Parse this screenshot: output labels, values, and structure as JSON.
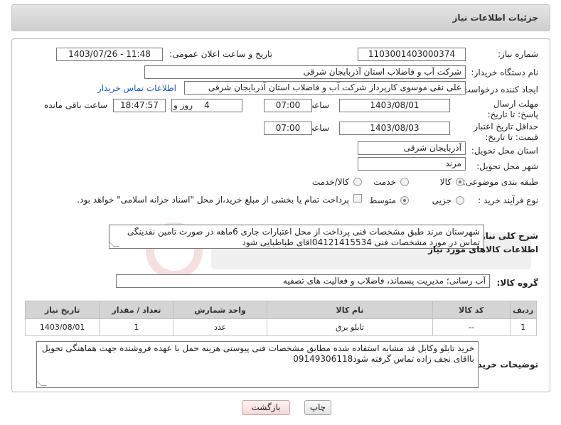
{
  "header": {
    "title": "جزئیات اطلاعات نیاز"
  },
  "form": {
    "need_number_label": "شماره نیاز:",
    "need_number": "1103001403000374",
    "announce_label": "تاریخ و ساعت اعلان عمومی:",
    "announce_value": "1403/07/26 - 11:48",
    "buyer_org_label": "نام دستگاه خریدار:",
    "buyer_org": "شرکت آب و فاضلاب استان آذربایجان شرقی",
    "creator_label": "ایجاد کننده درخواست:",
    "creator": "علی نقی موسوی کارپرداز شرکت آب و فاضلاب استان آذربایجان شرقی",
    "buyer_contact_link": "اطلاعات تماس خریدار",
    "reply_deadline_label": "مهلت ارسال پاسخ: تا تاریخ:",
    "reply_date": "1403/08/01",
    "time_label": "ساعت",
    "reply_time": "07:00",
    "days_value": "4",
    "days_label": "روز و",
    "remaining_time": "18:47:57",
    "remaining_label": "ساعت باقی مانده",
    "price_validity_label": "حداقل تاریخ اعتبار قیمت: تا تاریخ:",
    "price_date": "1403/08/03",
    "price_time": "07:00",
    "province_label": "استان محل تحویل:",
    "province": "آذربایجان شرقی",
    "city_label": "شهر محل تحویل:",
    "city": "مرند",
    "category_label": "طبقه بندی موضوعی:",
    "category_options": [
      "کالا",
      "خدمت",
      "کالا/خدمت"
    ],
    "process_label": "نوع فرآیند خرید :",
    "process_options": [
      "جزیی",
      "متوسط"
    ],
    "payment_note": "پرداخت تمام یا بخشی از مبلغ خرید،از محل \"اسناد خزانه اسلامی\" خواهد بود."
  },
  "description": {
    "label": "شرح کلی نیاز:",
    "text": "شهرستان مرند  طبق مشخصات فنی پرداخت از محل اعتبارات جاری  6ماهه در صورت تامین نقدینگی تماس در مورد مشخصات فنی 04121415534اقای  طباطبایی  شود"
  },
  "goods": {
    "section_title": "اطلاعات کالاهای مورد نیاز",
    "group_label": "گروه کالا:",
    "group_value": "آب رسانی؛ مدیریت پسماند، فاضلاب و فعالیت های تصفیه"
  },
  "table": {
    "columns": [
      "ردیف",
      "کد کالا",
      "نام کالا",
      "واحد شمارش",
      "تعداد / مقدار",
      "تاریخ نیاز"
    ],
    "rows": [
      [
        "1",
        "--",
        "تابلو برق",
        "عدد",
        "1",
        "1403/08/01"
      ]
    ]
  },
  "buyer_notes": {
    "label": "توضیحات خریدار:",
    "text": "خرید تابلو وکابل  قد مشابه استفاده شده مطابق مشخصات فنی پیوستی  هزینه حمل با عهده فروشنده جهت هماهنگی تحویل بااقای نجف زاده تماس گرفته شود09149306118"
  },
  "buttons": {
    "print": "چاپ",
    "back": "بازگشت"
  },
  "colors": {
    "link": "#1f5bc4",
    "header_bg": "#d8d8d8",
    "back_button": "#f4d8d8"
  }
}
